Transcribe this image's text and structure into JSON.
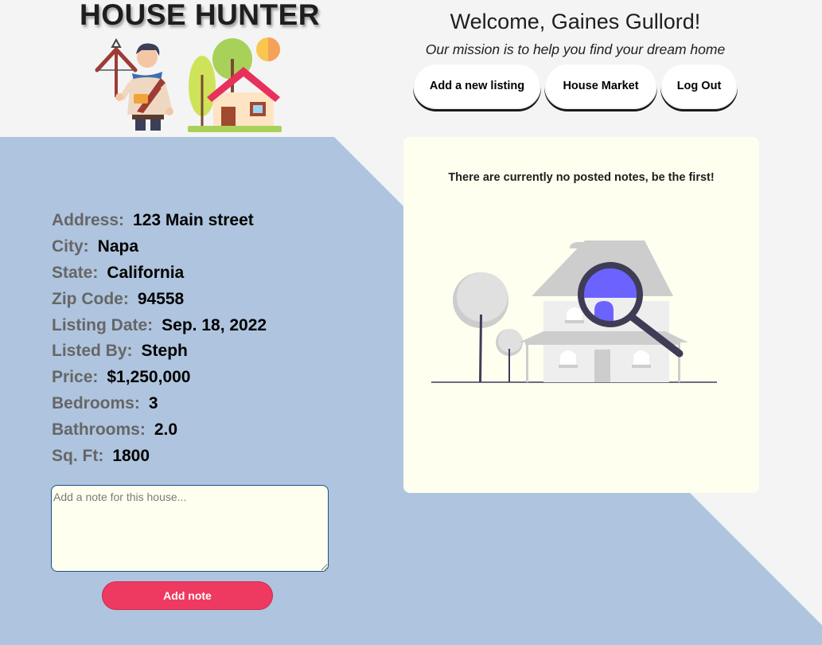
{
  "brand": {
    "title": "HOUSE HUNTER"
  },
  "header": {
    "welcome": "Welcome, Gaines Gullord!",
    "mission": "Our mission is to help you find your dream home"
  },
  "nav": {
    "add_listing": "Add a new listing",
    "house_market": "House Market",
    "log_out": "Log Out"
  },
  "listing": {
    "details": [
      {
        "label": "Address:",
        "value": "123 Main street"
      },
      {
        "label": "City:",
        "value": "Napa"
      },
      {
        "label": "State:",
        "value": "California"
      },
      {
        "label": "Zip Code:",
        "value": "94558"
      },
      {
        "label": "Listing Date:",
        "value": "Sep. 18, 2022"
      },
      {
        "label": "Listed By:",
        "value": "Steph"
      },
      {
        "label": "Price:",
        "value": "$1,250,000"
      },
      {
        "label": "Bedrooms:",
        "value": "3"
      },
      {
        "label": "Bathrooms:",
        "value": "2.0"
      },
      {
        "label": "Sq. Ft:",
        "value": "1800"
      }
    ]
  },
  "note_form": {
    "placeholder": "Add a note for this house...",
    "value": "",
    "submit_label": "Add note"
  },
  "notes": {
    "empty_message": "There are currently no posted notes, be the first!"
  },
  "icons": {
    "logo_hunter": "hunter-crossbow-icon",
    "logo_house": "house-with-trees-icon",
    "empty_illustration": "house-search-magnifier-illustration"
  },
  "colors": {
    "page_background": "#f4f4f4",
    "diagonal_band": "#afc4de",
    "panel_background": "#fffff0",
    "accent_button": "#ee3a60",
    "label_gray": "#666666",
    "magnifier_accent": "#6c63ff"
  }
}
